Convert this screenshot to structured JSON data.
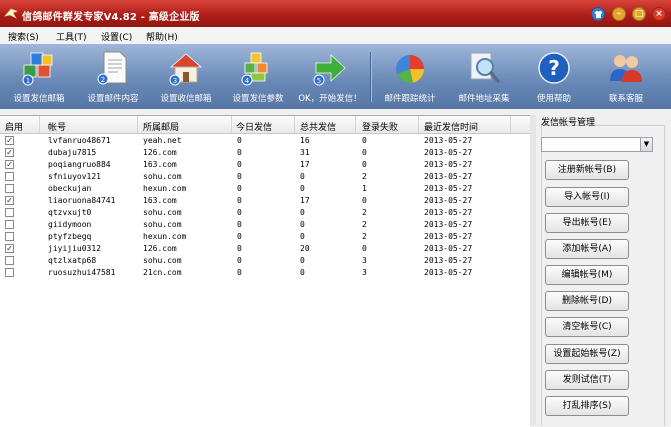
{
  "window": {
    "title": "信鸽邮件群发专家V4.82 - 高级企业版"
  },
  "menu": [
    {
      "label": "搜索(S)"
    },
    {
      "label": "工具(T)"
    },
    {
      "label": "设置(C)"
    },
    {
      "label": "帮助(H)"
    }
  ],
  "toolbar": [
    {
      "label": "设置发信邮箱",
      "icon": "cubes-icon"
    },
    {
      "label": "设置邮件内容",
      "icon": "document-icon"
    },
    {
      "label": "设置收信邮箱",
      "icon": "house-icon"
    },
    {
      "label": "设置发信参数",
      "icon": "blocks-icon"
    },
    {
      "label": "OK，开始发信！",
      "icon": "arrow-right-icon"
    },
    {
      "label": "邮件跟踪统计",
      "icon": "pie-chart-icon"
    },
    {
      "label": "邮件地址采集",
      "icon": "magnifier-icon"
    },
    {
      "label": "使用帮助",
      "icon": "help-icon"
    },
    {
      "label": "联系客服",
      "icon": "people-icon"
    }
  ],
  "table": {
    "headers": [
      "启用",
      "帐号",
      "所属邮局",
      "今日发信",
      "总共发信",
      "登录失败",
      "最近发信时间"
    ],
    "rows": [
      {
        "enabled": true,
        "account": "lvfanruo48671",
        "domain": "yeah.net",
        "today": "0",
        "total": "16",
        "fail": "0",
        "last": "2013-05-27"
      },
      {
        "enabled": true,
        "account": "dubaju7815",
        "domain": "126.com",
        "today": "0",
        "total": "31",
        "fail": "0",
        "last": "2013-05-27"
      },
      {
        "enabled": true,
        "account": "poqiangruo884",
        "domain": "163.com",
        "today": "0",
        "total": "17",
        "fail": "0",
        "last": "2013-05-27"
      },
      {
        "enabled": false,
        "account": "sfniuyov121",
        "domain": "sohu.com",
        "today": "0",
        "total": "0",
        "fail": "2",
        "last": "2013-05-27"
      },
      {
        "enabled": false,
        "account": "obeckujan",
        "domain": "hexun.com",
        "today": "0",
        "total": "0",
        "fail": "1",
        "last": "2013-05-27"
      },
      {
        "enabled": true,
        "account": "liaoruona84741",
        "domain": "163.com",
        "today": "0",
        "total": "17",
        "fail": "0",
        "last": "2013-05-27"
      },
      {
        "enabled": false,
        "account": "qtzvxujt0",
        "domain": "sohu.com",
        "today": "0",
        "total": "0",
        "fail": "2",
        "last": "2013-05-27"
      },
      {
        "enabled": false,
        "account": "giidymoon",
        "domain": "sohu.com",
        "today": "0",
        "total": "0",
        "fail": "2",
        "last": "2013-05-27"
      },
      {
        "enabled": false,
        "account": "ptyfzbegq",
        "domain": "hexun.com",
        "today": "0",
        "total": "0",
        "fail": "2",
        "last": "2013-05-27"
      },
      {
        "enabled": true,
        "account": "jiyijiu0312",
        "domain": "126.com",
        "today": "0",
        "total": "20",
        "fail": "0",
        "last": "2013-05-27"
      },
      {
        "enabled": false,
        "account": "qtzlxatp68",
        "domain": "sohu.com",
        "today": "0",
        "total": "0",
        "fail": "3",
        "last": "2013-05-27"
      },
      {
        "enabled": false,
        "account": "ruosuzhui47581",
        "domain": "21cn.com",
        "today": "0",
        "total": "0",
        "fail": "3",
        "last": "2013-05-27"
      }
    ]
  },
  "panel": {
    "title": "发信帐号管理",
    "combo_value": "",
    "buttons": [
      {
        "label": "注册新帐号(B)",
        "name": "register-account-button"
      },
      {
        "label": "导入帐号(I)",
        "name": "import-accounts-button"
      },
      {
        "label": "导出帐号(E)",
        "name": "export-accounts-button"
      },
      {
        "label": "添加帐号(A)",
        "name": "add-account-button"
      },
      {
        "label": "编辑帐号(M)",
        "name": "edit-account-button"
      },
      {
        "label": "删除帐号(D)",
        "name": "delete-account-button"
      },
      {
        "label": "清空帐号(C)",
        "name": "clear-accounts-button"
      },
      {
        "label": "设置起始帐号(Z)",
        "name": "set-start-account-button"
      },
      {
        "label": "发则试信(T)",
        "name": "send-test-button"
      },
      {
        "label": "打乱排序(S)",
        "name": "shuffle-order-button"
      }
    ]
  }
}
